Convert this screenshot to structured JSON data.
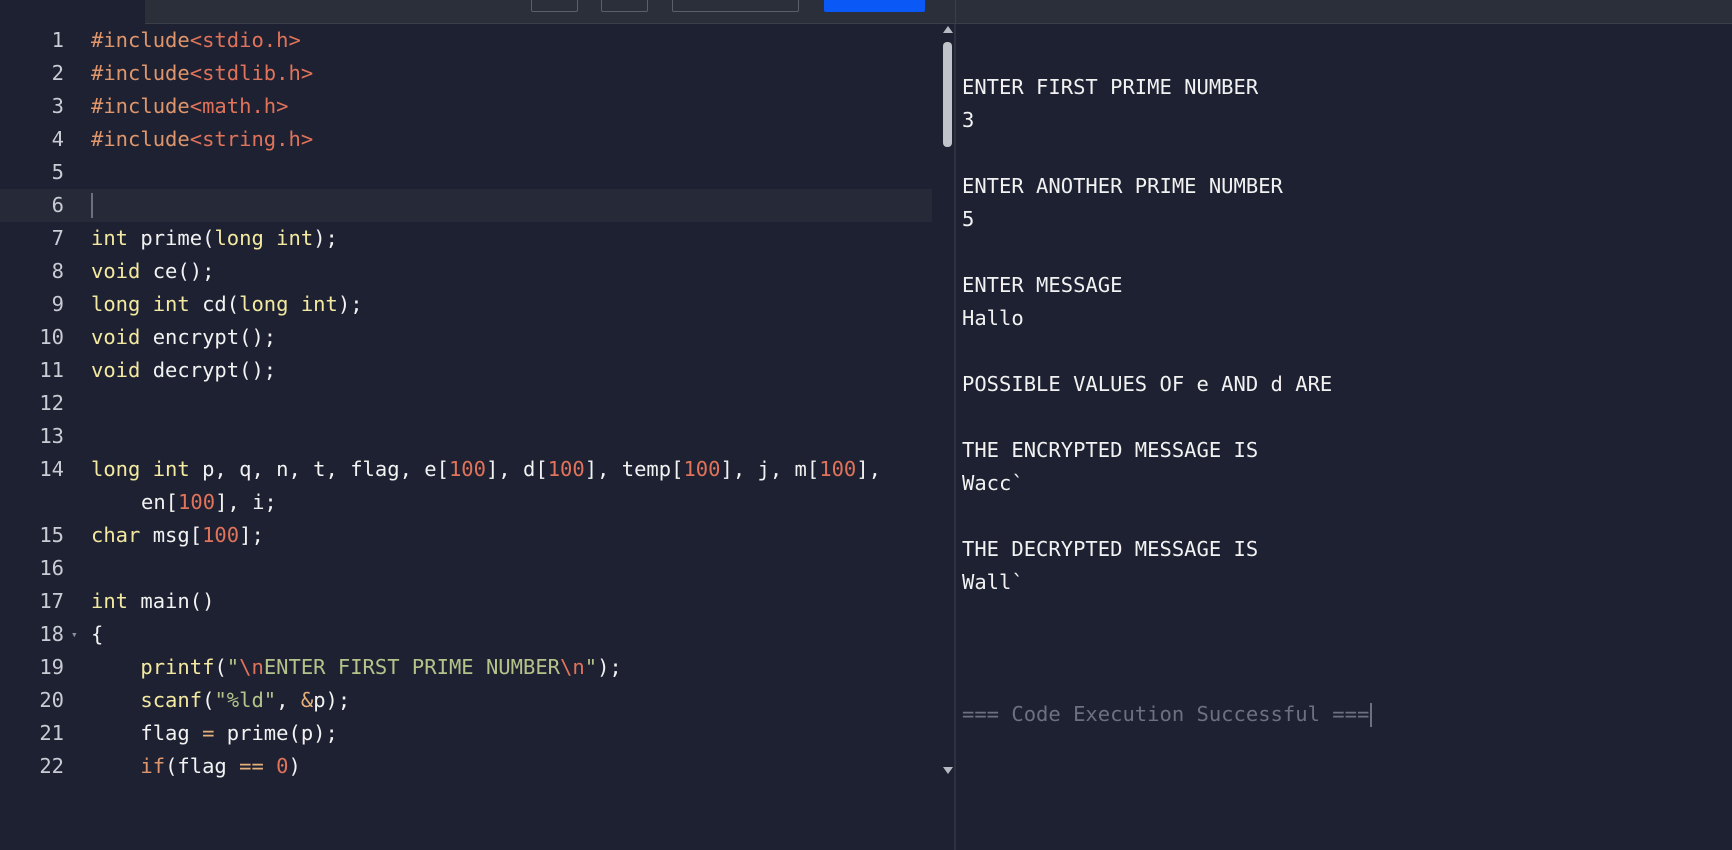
{
  "editor": {
    "lines": [
      {
        "n": "1",
        "parts": [
          {
            "t": "#include",
            "c": "pp"
          },
          {
            "t": "<stdio.h>",
            "c": "inc"
          }
        ]
      },
      {
        "n": "2",
        "parts": [
          {
            "t": "#include",
            "c": "pp"
          },
          {
            "t": "<stdlib.h>",
            "c": "inc"
          }
        ]
      },
      {
        "n": "3",
        "parts": [
          {
            "t": "#include",
            "c": "pp"
          },
          {
            "t": "<math.h>",
            "c": "inc"
          }
        ]
      },
      {
        "n": "4",
        "parts": [
          {
            "t": "#include",
            "c": "pp"
          },
          {
            "t": "<string.h>",
            "c": "inc"
          }
        ]
      },
      {
        "n": "5",
        "parts": []
      },
      {
        "n": "6",
        "parts": [],
        "active": true
      },
      {
        "n": "7",
        "parts": [
          {
            "t": "int",
            "c": "k"
          },
          {
            "t": " prime("
          },
          {
            "t": "long int",
            "c": "k"
          },
          {
            "t": ");"
          }
        ]
      },
      {
        "n": "8",
        "parts": [
          {
            "t": "void",
            "c": "k"
          },
          {
            "t": " ce();"
          }
        ]
      },
      {
        "n": "9",
        "parts": [
          {
            "t": "long int",
            "c": "k"
          },
          {
            "t": " cd("
          },
          {
            "t": "long int",
            "c": "k"
          },
          {
            "t": ");"
          }
        ]
      },
      {
        "n": "10",
        "parts": [
          {
            "t": "void",
            "c": "k"
          },
          {
            "t": " encrypt();"
          }
        ]
      },
      {
        "n": "11",
        "parts": [
          {
            "t": "void",
            "c": "k"
          },
          {
            "t": " decrypt();"
          }
        ]
      },
      {
        "n": "12",
        "parts": []
      },
      {
        "n": "13",
        "parts": []
      },
      {
        "n": "14",
        "parts": [
          {
            "t": "long int",
            "c": "k"
          },
          {
            "t": " p, q, n, t, flag, e["
          },
          {
            "t": "100",
            "c": "num"
          },
          {
            "t": "], d["
          },
          {
            "t": "100",
            "c": "num"
          },
          {
            "t": "], temp["
          },
          {
            "t": "100",
            "c": "num"
          },
          {
            "t": "], j, m["
          },
          {
            "t": "100",
            "c": "num"
          },
          {
            "t": "],"
          }
        ]
      },
      {
        "n": "",
        "cont": true,
        "parts": [
          {
            "t": "en["
          },
          {
            "t": "100",
            "c": "num"
          },
          {
            "t": "], i;"
          }
        ]
      },
      {
        "n": "15",
        "parts": [
          {
            "t": "char",
            "c": "k"
          },
          {
            "t": " msg["
          },
          {
            "t": "100",
            "c": "num"
          },
          {
            "t": "];"
          }
        ]
      },
      {
        "n": "16",
        "parts": []
      },
      {
        "n": "17",
        "parts": [
          {
            "t": "int",
            "c": "k"
          },
          {
            "t": " main()"
          }
        ]
      },
      {
        "n": "18",
        "fold": true,
        "parts": [
          {
            "t": "{"
          }
        ]
      },
      {
        "n": "19",
        "parts": [
          {
            "t": "    "
          },
          {
            "t": "printf",
            "c": "fn"
          },
          {
            "t": "("
          },
          {
            "t": "\"",
            "c": "str"
          },
          {
            "t": "\\n",
            "c": "esc"
          },
          {
            "t": "ENTER FIRST PRIME NUMBER",
            "c": "str"
          },
          {
            "t": "\\n",
            "c": "esc"
          },
          {
            "t": "\"",
            "c": "str"
          },
          {
            "t": ");"
          }
        ]
      },
      {
        "n": "20",
        "parts": [
          {
            "t": "    "
          },
          {
            "t": "scanf",
            "c": "fn"
          },
          {
            "t": "("
          },
          {
            "t": "\"%ld\"",
            "c": "str"
          },
          {
            "t": ", "
          },
          {
            "t": "&",
            "c": "op"
          },
          {
            "t": "p);"
          }
        ]
      },
      {
        "n": "21",
        "parts": [
          {
            "t": "    flag "
          },
          {
            "t": "=",
            "c": "op"
          },
          {
            "t": " prime(p);"
          }
        ]
      },
      {
        "n": "22",
        "parts": [
          {
            "t": "    "
          },
          {
            "t": "if",
            "c": "pp"
          },
          {
            "t": "(flag "
          },
          {
            "t": "==",
            "c": "op"
          },
          {
            "t": " "
          },
          {
            "t": "0",
            "c": "num"
          },
          {
            "t": ")"
          }
        ]
      }
    ]
  },
  "output": {
    "lines": [
      "",
      "ENTER FIRST PRIME NUMBER",
      "3",
      "",
      "ENTER ANOTHER PRIME NUMBER",
      "5",
      "",
      "ENTER MESSAGE",
      "Hallo",
      "",
      "POSSIBLE VALUES OF e AND d ARE",
      "",
      "THE ENCRYPTED MESSAGE IS",
      "Wacc`",
      "",
      "THE DECRYPTED MESSAGE IS",
      "Wall`",
      "",
      "",
      ""
    ],
    "status": "=== Code Execution Successful ==="
  },
  "colors": {
    "background": "#1d2131",
    "run_button": "#0a58f5",
    "keyword": "#f4e9a0",
    "string": "#b5c38a",
    "number": "#e0735a"
  }
}
